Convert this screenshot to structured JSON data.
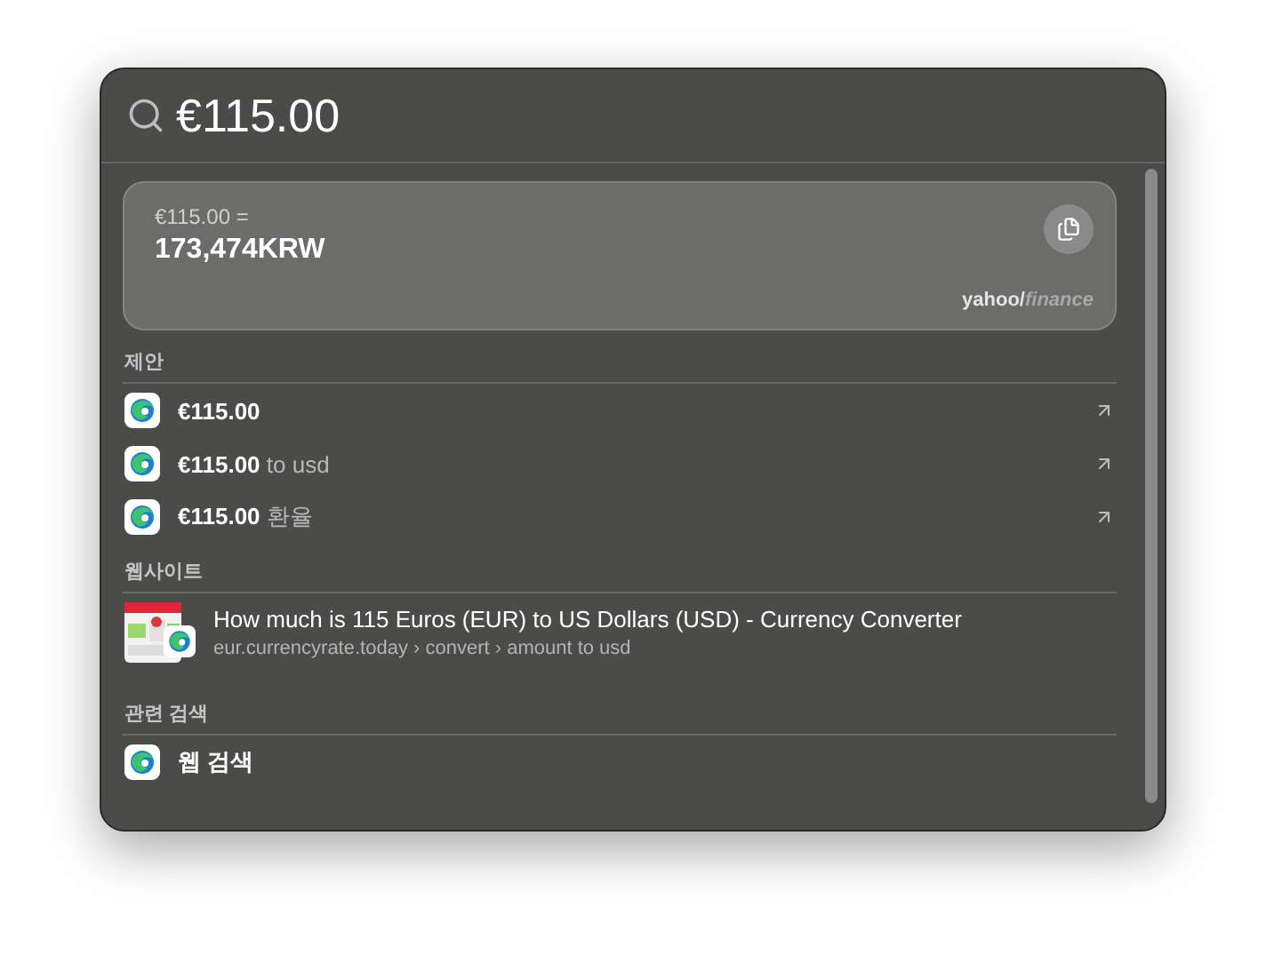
{
  "search": {
    "value": "€115.00"
  },
  "conversion": {
    "from": "€115.00 =",
    "result": "173,474KRW",
    "source": {
      "main": "yahoo/",
      "sub": "finance"
    }
  },
  "sections": [
    {
      "kind": "suggestions",
      "title": "제안",
      "items": [
        {
          "query": "€115.00"
        },
        {
          "query": "€115.00",
          "suffix": "to usd"
        },
        {
          "query": "€115.00",
          "suffix": "환율"
        }
      ]
    },
    {
      "kind": "websites",
      "title": "웹사이트",
      "items": [
        {
          "title": "How much is 115 Euros (EUR) to US Dollars (USD) - Currency Converter",
          "url": "eur.currencyrate.today › convert › amount to usd"
        }
      ]
    },
    {
      "kind": "related",
      "title": "관련 검색",
      "items": [
        {
          "query": "웹 검색"
        }
      ]
    }
  ]
}
